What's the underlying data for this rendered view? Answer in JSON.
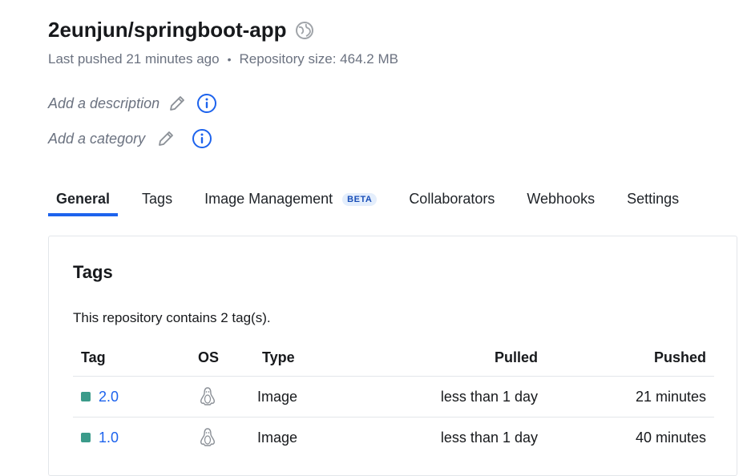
{
  "repo": {
    "name": "2eunjun/springboot-app",
    "last_pushed": "Last pushed 21 minutes ago",
    "separator": "•",
    "size": "Repository size: 464.2 MB",
    "description_placeholder": "Add a description",
    "category_placeholder": "Add a category"
  },
  "tabs": [
    {
      "label": "General",
      "active": true
    },
    {
      "label": "Tags"
    },
    {
      "label": "Image Management",
      "badge": "BETA"
    },
    {
      "label": "Collaborators"
    },
    {
      "label": "Webhooks"
    },
    {
      "label": "Settings"
    }
  ],
  "tags_panel": {
    "title": "Tags",
    "summary": "This repository contains 2 tag(s).",
    "headers": {
      "tag": "Tag",
      "os": "OS",
      "type": "Type",
      "pulled": "Pulled",
      "pushed": "Pushed"
    },
    "rows": [
      {
        "tag": "2.0",
        "os_icon": "linux-icon",
        "type": "Image",
        "pulled": "less than 1 day",
        "pushed": "21 minutes"
      },
      {
        "tag": "1.0",
        "os_icon": "linux-icon",
        "type": "Image",
        "pulled": "less than 1 day",
        "pushed": "40 minutes"
      }
    ]
  },
  "colors": {
    "accent": "#1d63ed",
    "tag_status": "#3b9b8a",
    "muted": "#6b7280"
  }
}
